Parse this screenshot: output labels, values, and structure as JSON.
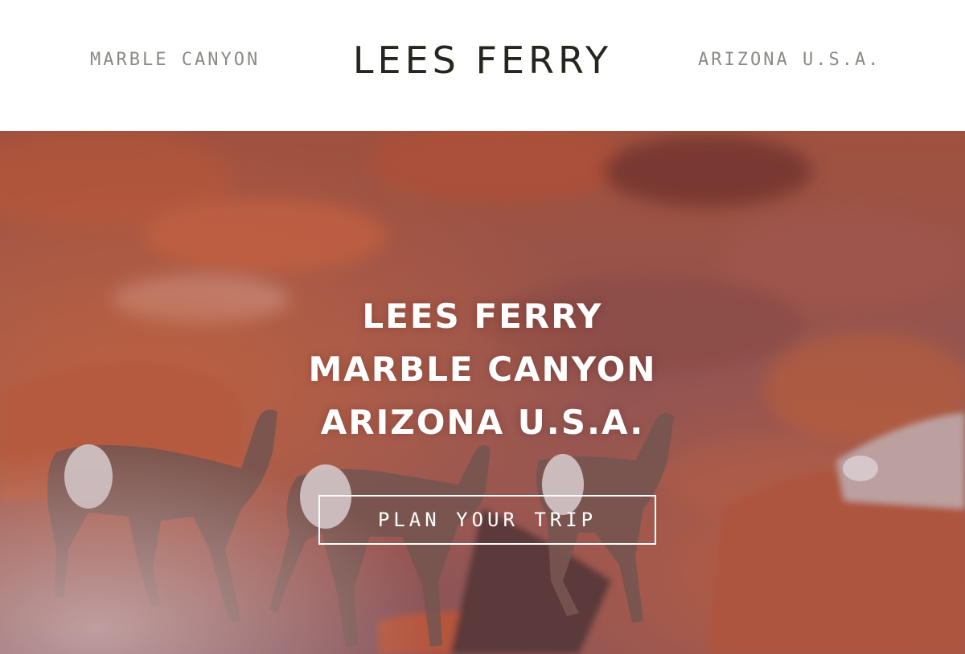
{
  "header": {
    "left_label": "MARBLE CANYON",
    "brand": "LEES FERRY",
    "right_label": "ARIZONA U.S.A."
  },
  "hero": {
    "lines": [
      "LEES FERRY",
      "MARBLE CANYON",
      "ARIZONA U.S.A."
    ],
    "cta_label": "PLAN YOUR TRIP",
    "image_subject": "bighorn-sheep-on-red-rock-canyon-slope"
  },
  "colors": {
    "header_bg": "#ffffff",
    "brand_text": "#23271f",
    "header_side_text": "#8a8a86",
    "hero_text": "#ffffff",
    "rock_red": "#b85a40",
    "rock_mauve": "#8f5a5e"
  }
}
